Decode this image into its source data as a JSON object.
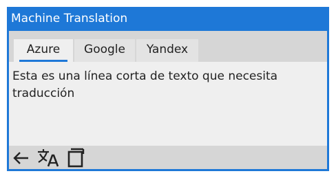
{
  "window": {
    "title": "Machine Translation"
  },
  "tabs": {
    "items": [
      {
        "label": "Azure",
        "selected": true
      },
      {
        "label": "Google",
        "selected": false
      },
      {
        "label": "Yandex",
        "selected": false
      }
    ]
  },
  "translation": {
    "text": "Esta es una línea corta de texto que necesita traducción"
  },
  "toolbar": {
    "back_icon": "arrow-left-icon",
    "translate_icon": "translate-icon",
    "copy_icon": "copy-icon"
  },
  "colors": {
    "accent": "#1e78d7",
    "tab_bar": "#d6d6d6",
    "content_bg": "#efefef"
  }
}
